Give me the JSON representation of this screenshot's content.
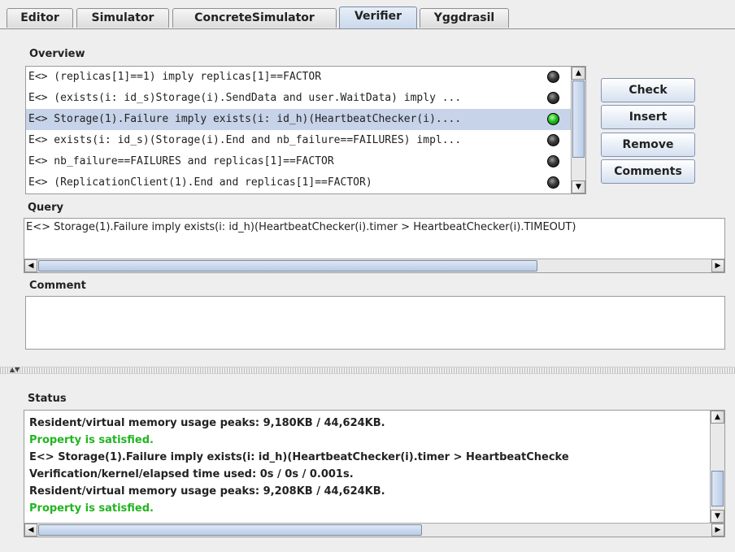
{
  "tabs": [
    {
      "label": "Editor",
      "active": false
    },
    {
      "label": "Simulator",
      "active": false
    },
    {
      "label": "ConcreteSimulator",
      "active": false
    },
    {
      "label": "Verifier",
      "active": true
    },
    {
      "label": "Yggdrasil",
      "active": false
    }
  ],
  "overview": {
    "label": "Overview",
    "queries": [
      {
        "text": "E<> (replicas[1]==1) imply replicas[1]==FACTOR",
        "status": "unchecked"
      },
      {
        "text": "E<> (exists(i: id_s)Storage(i).SendData and user.WaitData) imply ...",
        "status": "unchecked"
      },
      {
        "text": "E<> Storage(1).Failure imply exists(i: id_h)(HeartbeatChecker(i)....",
        "status": "satisfied",
        "selected": true
      },
      {
        "text": "E<> exists(i: id_s)(Storage(i).End and nb_failure==FAILURES) impl...",
        "status": "unchecked"
      },
      {
        "text": "E<> nb_failure==FAILURES and replicas[1]==FACTOR",
        "status": "unchecked"
      },
      {
        "text": "E<> (ReplicationClient(1).End and replicas[1]==FACTOR)",
        "status": "unchecked"
      }
    ]
  },
  "buttons": {
    "check": "Check",
    "insert": "Insert",
    "remove": "Remove",
    "comments": "Comments"
  },
  "query": {
    "label": "Query",
    "value": "E<> Storage(1).Failure imply exists(i: id_h)(HeartbeatChecker(i).timer > HeartbeatChecker(i).TIMEOUT)"
  },
  "comment": {
    "label": "Comment",
    "value": ""
  },
  "status": {
    "label": "Status",
    "lines": [
      {
        "text": "Resident/virtual memory usage peaks: 9,180KB / 44,624KB.",
        "kind": "normal"
      },
      {
        "text": "Property is satisfied.",
        "kind": "ok"
      },
      {
        "text": "E<> Storage(1).Failure imply exists(i: id_h)(HeartbeatChecker(i).timer > HeartbeatChecke",
        "kind": "normal"
      },
      {
        "text": "Verification/kernel/elapsed time used: 0s / 0s / 0.001s.",
        "kind": "normal"
      },
      {
        "text": "Resident/virtual memory usage peaks: 9,208KB / 44,624KB.",
        "kind": "normal"
      },
      {
        "text": "Property is satisfied.",
        "kind": "ok"
      }
    ]
  },
  "colors": {
    "satisfied": "#22b422",
    "selection": "#c6d3e9",
    "accent": "#7a8aa5"
  },
  "icons": {
    "scroll_up": "arrow-up-icon",
    "scroll_down": "arrow-down-icon",
    "scroll_left": "arrow-left-icon",
    "scroll_right": "arrow-right-icon"
  }
}
